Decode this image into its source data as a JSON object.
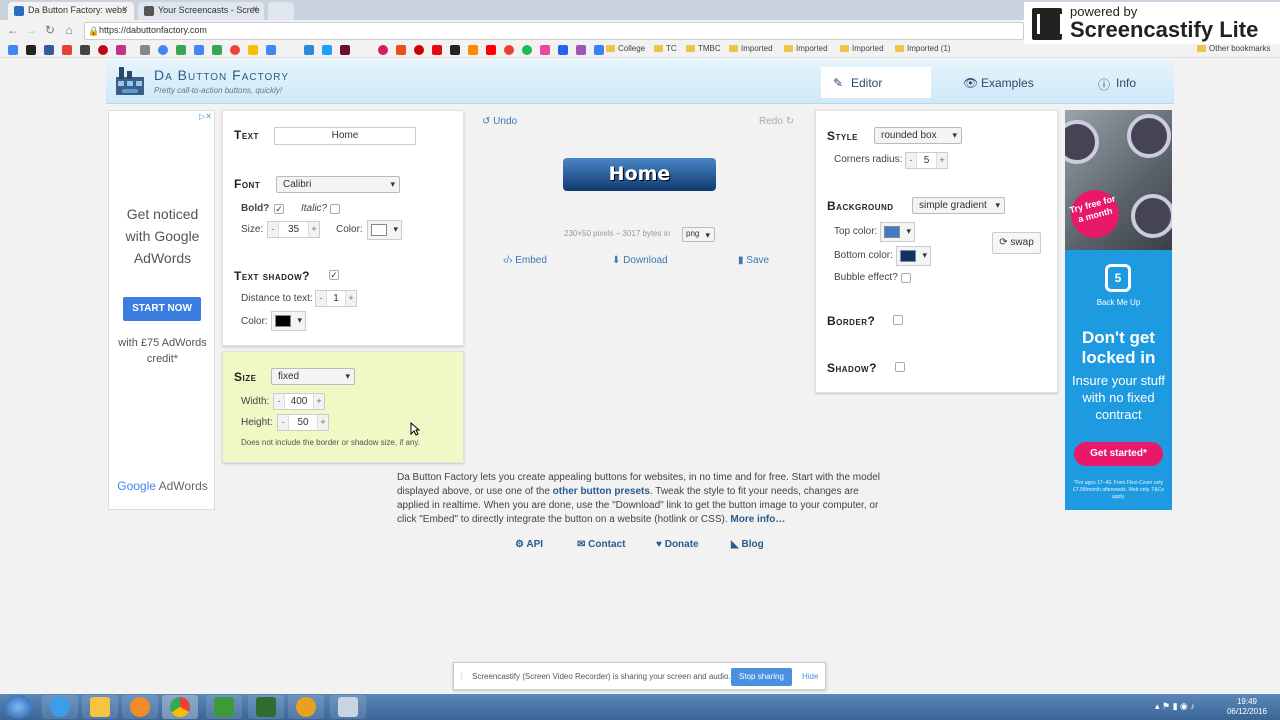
{
  "browser": {
    "tabs": [
      {
        "title": "Da Button Factory: webs",
        "active": true
      },
      {
        "title": "Your Screencasts - Scree",
        "active": false
      }
    ],
    "url": "https://dabuttonfactory.com",
    "bookmark_folders": [
      "College",
      "TC",
      "TMBC",
      "Imported",
      "Imported",
      "Imported",
      "Imported (1)"
    ],
    "other_bookmarks": "Other bookmarks"
  },
  "castify": {
    "powered": "powered by",
    "name": "Screencastify Lite"
  },
  "site": {
    "brand": "Da Button Factory",
    "tagline": "Pretty call-to-action buttons, quickly!",
    "nav": {
      "editor": "Editor",
      "examples": "Examples",
      "info": "Info"
    }
  },
  "left_ad": {
    "line1": "Get noticed with Google AdWords",
    "button": "START NOW",
    "credit": "with £75 AdWords credit*",
    "footer_google": "Google",
    "footer_adwords": "AdWords"
  },
  "text_panel": {
    "text_label": "Text",
    "text_value": "Home",
    "font_label": "Font",
    "font_value": "Calibri",
    "bold_label": "Bold?",
    "italic_label": "Italic?",
    "size_label": "Size:",
    "size_value": "35",
    "color_label": "Color:",
    "text_color": "#ffffff",
    "shadow_label": "Text shadow?",
    "distance_label": "Distance to text:",
    "distance_value": "1",
    "shadow_color_label": "Color:",
    "shadow_color": "#000000"
  },
  "size_panel": {
    "size_label": "Size",
    "size_mode": "fixed",
    "width_label": "Width:",
    "width_value": "400",
    "height_label": "Height:",
    "height_value": "50",
    "note": "Does not include the border or shadow size, if any."
  },
  "preview": {
    "undo": "Undo",
    "redo": "Redo",
    "button_text": "Home",
    "dims": "230×50 pixels – 3017 bytes in",
    "format": "png",
    "embed": "Embed",
    "download": "Download",
    "save": "Save"
  },
  "style_panel": {
    "style_label": "Style",
    "style_value": "rounded box",
    "corners_label": "Corners radius:",
    "corners_value": "5",
    "background_label": "Background",
    "background_value": "simple gradient",
    "top_color_label": "Top color:",
    "top_color": "#3d7cc4",
    "bottom_color_label": "Bottom color:",
    "bottom_color": "#0a3263",
    "swap": "swap",
    "bubble_label": "Bubble effect?",
    "border_label": "Border?",
    "shadow_label": "Shadow?"
  },
  "right_ad": {
    "bubble": "Try free for a month",
    "brand": "Back Me Up",
    "headline": "Don't get locked in",
    "body": "Insure your stuff with no fixed contract",
    "cta": "Get started*",
    "fine": "*For ages 17–49. From Flexi-Cover only £7.99/month afterwards. Web only. T&Cs apply."
  },
  "info": {
    "part1": "Da Button Factory lets you create appealing buttons for websites, in no time and for free. Start with the model displayed above, or use one of the ",
    "presets": "other button presets",
    "part2": ". Tweak the style to fit your needs, changes are applied in realtime. When you are done, use the \"Download\" link to get the button image to your computer, or click \"Embed\" to directly integrate the button on a website (hotlink or CSS). ",
    "more": "More info…"
  },
  "footer_links": {
    "api": "API",
    "contact": "Contact",
    "donate": "Donate",
    "blog": "Blog"
  },
  "notification": {
    "text": "Screencastify (Screen Video Recorder) is sharing your screen and audio.",
    "stop": "Stop sharing",
    "hide": "Hide"
  },
  "clock": {
    "time": "19:49",
    "date": "06/12/2016"
  }
}
